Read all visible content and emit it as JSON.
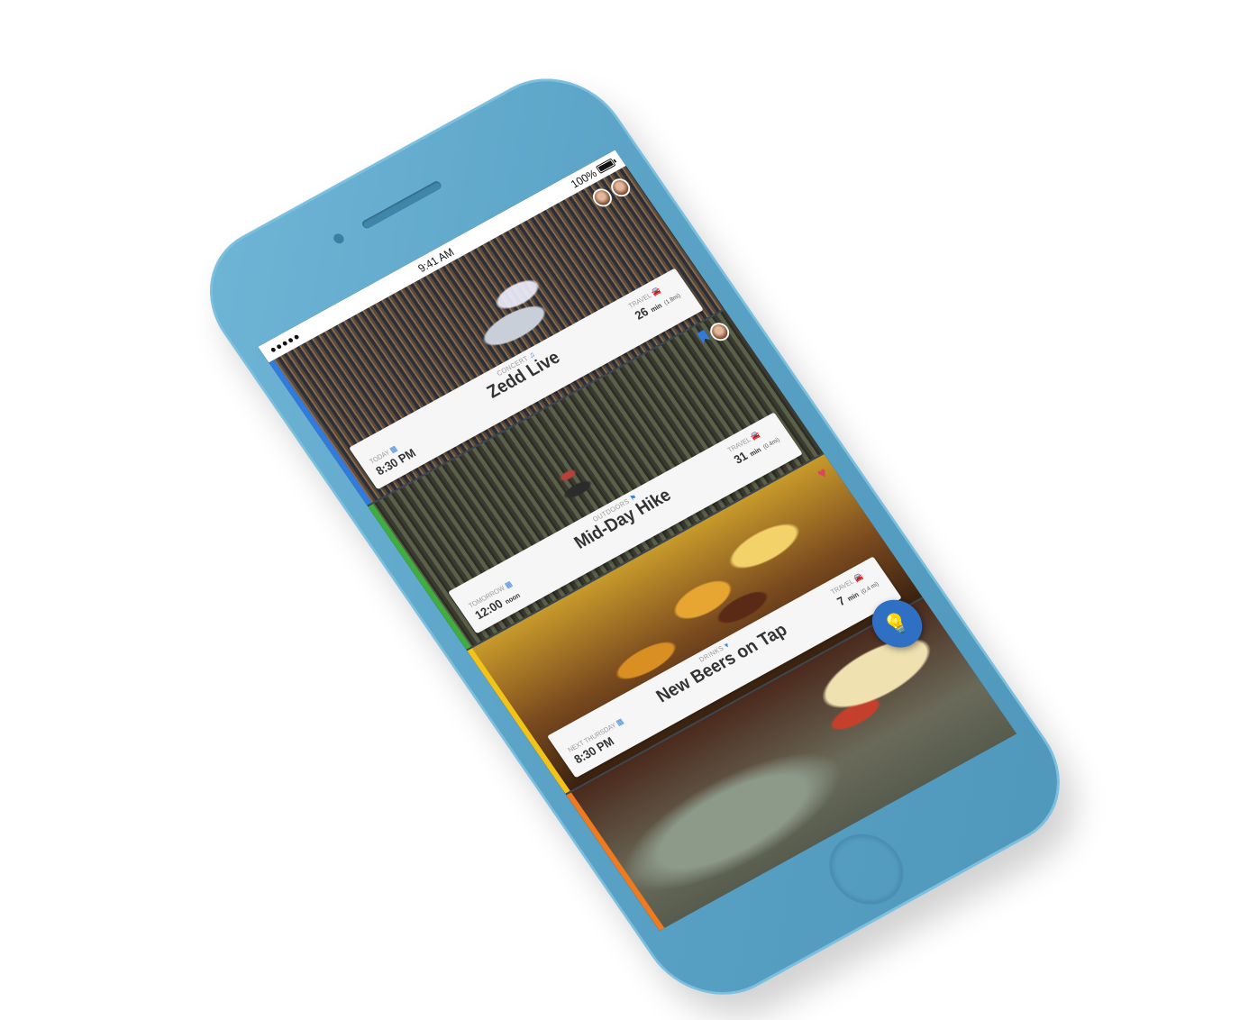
{
  "status_bar": {
    "signal": "●●●●●",
    "time": "9:41 AM",
    "battery": "100%"
  },
  "cards": [
    {
      "category": "CONCERT",
      "title": "Zedd Live",
      "when_label": "TODAY",
      "when_value": "8:30 PM",
      "when_suffix": "",
      "travel_label": "TRAVEL",
      "travel_value": "26",
      "travel_unit": "min",
      "travel_dist": "(1.8mi)",
      "accent": "#2f7be0"
    },
    {
      "category": "OUTDOORS",
      "title": "Mid-Day Hike",
      "when_label": "TOMORROW",
      "when_value": "12:00",
      "when_suffix": "noon",
      "travel_label": "TRAVEL",
      "travel_value": "31",
      "travel_unit": "min",
      "travel_dist": "(0.4mi)",
      "accent": "#3fae3f"
    },
    {
      "category": "DRINKS",
      "title": "New Beers on Tap",
      "when_label": "NEXT THURSDAY",
      "when_value": "8:30 PM",
      "when_suffix": "",
      "travel_label": "TRAVEL",
      "travel_value": "7",
      "travel_unit": "min",
      "travel_dist": "(0.4 mi)",
      "accent": "#f2c318"
    },
    {
      "accent": "#f07a1f"
    }
  ],
  "icons": {
    "calendar": "calendar-icon",
    "car": "car-icon",
    "bulb": "lightbulb-icon",
    "heart": "heart-icon",
    "bookmark": "bookmark-icon"
  },
  "colors": {
    "device": "#5aa3c6",
    "fab": "#2f6fc4"
  }
}
